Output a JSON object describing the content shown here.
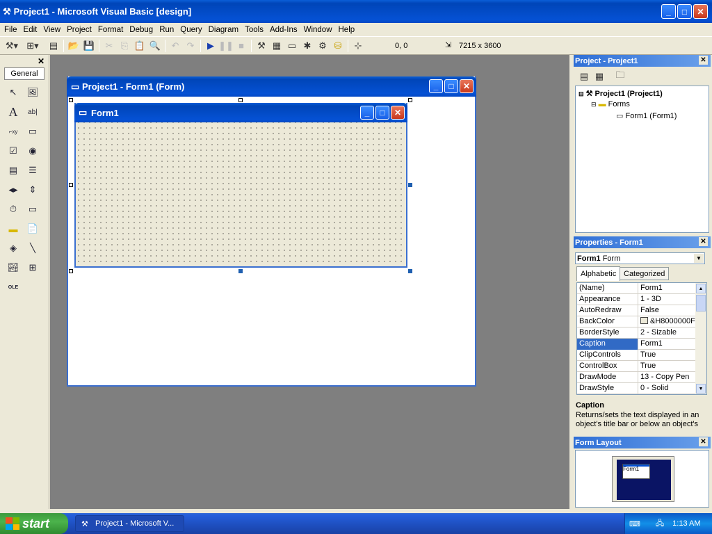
{
  "window": {
    "title": "Project1 - Microsoft Visual Basic [design]"
  },
  "menu": [
    "File",
    "Edit",
    "View",
    "Project",
    "Format",
    "Debug",
    "Run",
    "Query",
    "Diagram",
    "Tools",
    "Add-Ins",
    "Window",
    "Help"
  ],
  "toolbar": {
    "coords": "0, 0",
    "size": "7215 x 3600"
  },
  "toolbox": {
    "tab": "General"
  },
  "designer": {
    "title": "Project1 - Form1 (Form)"
  },
  "form": {
    "caption": "Form1"
  },
  "project": {
    "title": "Project - Project1",
    "root": "Project1 (Project1)",
    "folder": "Forms",
    "item": "Form1 (Form1)"
  },
  "properties": {
    "title": "Properties - Form1",
    "object_name": "Form1",
    "object_type": "Form",
    "tabs": [
      "Alphabetic",
      "Categorized"
    ],
    "rows": [
      {
        "name": "(Name)",
        "value": "Form1"
      },
      {
        "name": "Appearance",
        "value": "1 - 3D"
      },
      {
        "name": "AutoRedraw",
        "value": "False"
      },
      {
        "name": "BackColor",
        "value": "&H8000000F"
      },
      {
        "name": "BorderStyle",
        "value": "2 - Sizable"
      },
      {
        "name": "Caption",
        "value": "Form1"
      },
      {
        "name": "ClipControls",
        "value": "True"
      },
      {
        "name": "ControlBox",
        "value": "True"
      },
      {
        "name": "DrawMode",
        "value": "13 - Copy Pen"
      },
      {
        "name": "DrawStyle",
        "value": "0 - Solid"
      }
    ],
    "selected": "Caption",
    "desc_title": "Caption",
    "desc_text": "Returns/sets the text displayed in an object's title bar or below an object's"
  },
  "form_layout": {
    "title": "Form Layout",
    "mini_caption": "Form1"
  },
  "taskbar": {
    "start": "start",
    "task": "Project1 - Microsoft V...",
    "clock": "1:13 AM"
  }
}
